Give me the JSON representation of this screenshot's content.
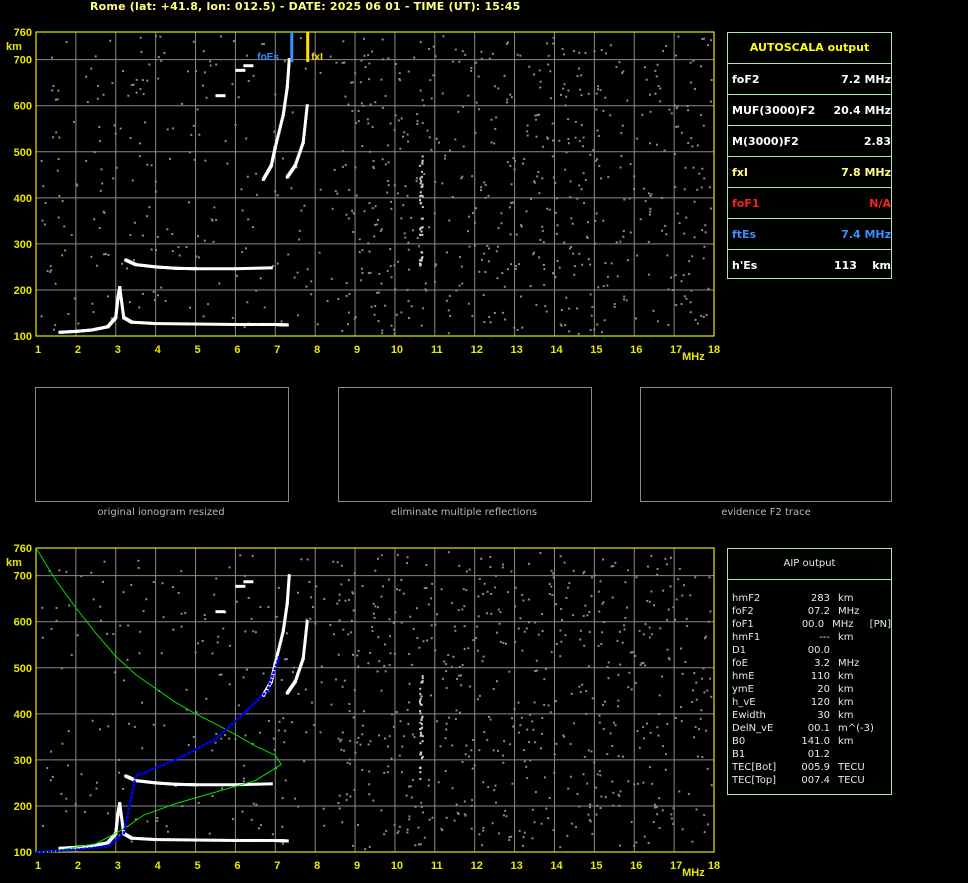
{
  "header": "Rome (lat: +41.8, lon: 012.5) - DATE: 2025 06 01 - TIME (UT): 15:45",
  "colors": {
    "axis": "#e8e800",
    "grid": "#8a8a8a",
    "trace": "#ffffff",
    "profile": "#0000ff",
    "model": "#00e000",
    "foEs": "#3a8fff",
    "fxI": "#ffe000",
    "foF1": "#ff2020"
  },
  "autoscala": {
    "title": "AUTOSCALA output",
    "rows": [
      {
        "label": "foF2",
        "value": "7.2",
        "unit": "MHz",
        "color": "#ffffff"
      },
      {
        "label": "MUF(3000)F2",
        "value": "20.4",
        "unit": "MHz",
        "color": "#ffffff"
      },
      {
        "label": "M(3000)F2",
        "value": "2.83",
        "unit": "",
        "color": "#ffffff"
      },
      {
        "label": "fxI",
        "value": "7.8",
        "unit": "MHz",
        "color": "#ffff80"
      },
      {
        "label": "foF1",
        "value": "N/A",
        "unit": "",
        "color": "#ff2020"
      },
      {
        "label": "ftEs",
        "value": "7.4",
        "unit": "MHz",
        "color": "#3a8fff"
      },
      {
        "label": "h'Es",
        "value": "113",
        "unit": "km",
        "color": "#ffffff"
      }
    ]
  },
  "aip": {
    "title": "AIP output",
    "rows": [
      {
        "k": "hmF2",
        "v": "283",
        "u": "km",
        "x": ""
      },
      {
        "k": "foF2",
        "v": "07.2",
        "u": "MHz",
        "x": ""
      },
      {
        "k": "foF1",
        "v": "00.0",
        "u": "MHz",
        "x": "[PN]"
      },
      {
        "k": "hmF1",
        "v": "---",
        "u": "km",
        "x": ""
      },
      {
        "k": "D1",
        "v": "00.0",
        "u": "",
        "x": ""
      },
      {
        "k": "foE",
        "v": "3.2",
        "u": "MHz",
        "x": ""
      },
      {
        "k": "hmE",
        "v": "110",
        "u": "km",
        "x": ""
      },
      {
        "k": "ymE",
        "v": "20",
        "u": "km",
        "x": ""
      },
      {
        "k": "h_vE",
        "v": "120",
        "u": "km",
        "x": ""
      },
      {
        "k": "Ewidth",
        "v": "30",
        "u": "km",
        "x": ""
      },
      {
        "k": "DelN_vE",
        "v": "00.1",
        "u": "m^(-3)",
        "x": ""
      },
      {
        "k": "B0",
        "v": "141.0",
        "u": "km",
        "x": ""
      },
      {
        "k": "B1",
        "v": "01.2",
        "u": "",
        "x": ""
      },
      {
        "k": "TEC[Bot]",
        "v": "005.9",
        "u": "TECU",
        "x": ""
      },
      {
        "k": "TEC[Top]",
        "v": "007.4",
        "u": "TECU",
        "x": ""
      }
    ]
  },
  "thumbnails": [
    {
      "caption": "original ionogram resized"
    },
    {
      "caption": "eliminate multiple reflections"
    },
    {
      "caption": "evidence F2 trace"
    }
  ],
  "chart_data": [
    {
      "type": "scatter",
      "title": "",
      "xlabel": "MHz",
      "ylabel": "km",
      "xlim": [
        1,
        18
      ],
      "ylim": [
        100,
        760
      ],
      "xticks": [
        1,
        2,
        3,
        4,
        5,
        6,
        7,
        8,
        9,
        10,
        11,
        12,
        13,
        14,
        15,
        16,
        17,
        18
      ],
      "yticks": [
        100,
        200,
        300,
        400,
        500,
        600,
        700,
        760
      ],
      "grid": true,
      "markers": [
        {
          "label": "foEs",
          "x": 7.4,
          "color": "#3a8fff"
        },
        {
          "label": "fxI",
          "x": 7.8,
          "color": "#ffe000"
        }
      ],
      "series": [
        {
          "name": "",
          "values": [
            [
              1.6,
              108
            ],
            [
              2.0,
              110
            ],
            [
              2.4,
              113
            ],
            [
              2.8,
              120
            ],
            [
              3.0,
              140
            ],
            [
              3.05,
              180
            ],
            [
              3.1,
              205
            ],
            [
              3.2,
              140
            ],
            [
              3.4,
              130
            ],
            [
              4,
              127
            ],
            [
              5,
              126
            ],
            [
              6,
              125
            ],
            [
              7,
              125
            ],
            [
              7.3,
              124
            ]
          ]
        },
        {
          "name": "",
          "values": [
            [
              3.25,
              265
            ],
            [
              3.5,
              255
            ],
            [
              4,
              250
            ],
            [
              4.5,
              247
            ],
            [
              5,
              246
            ],
            [
              6,
              246
            ],
            [
              6.9,
              248
            ]
          ]
        },
        {
          "name": "",
          "values": [
            [
              6.7,
              440
            ],
            [
              6.9,
              470
            ],
            [
              7.0,
              510
            ],
            [
              7.2,
              580
            ],
            [
              7.3,
              640
            ],
            [
              7.35,
              700
            ]
          ]
        },
        {
          "name": "",
          "values": [
            [
              7.3,
              445
            ],
            [
              7.5,
              470
            ],
            [
              7.7,
              520
            ],
            [
              7.8,
              600
            ]
          ]
        }
      ]
    },
    {
      "type": "line",
      "title": "",
      "xlabel": "MHz",
      "ylabel": "km",
      "xlim": [
        1,
        18
      ],
      "ylim": [
        100,
        760
      ],
      "xticks": [
        1,
        2,
        3,
        4,
        5,
        6,
        7,
        8,
        9,
        10,
        11,
        12,
        13,
        14,
        15,
        16,
        17,
        18
      ],
      "yticks": [
        100,
        200,
        300,
        400,
        500,
        600,
        700,
        760
      ],
      "grid": true,
      "series": [
        {
          "name": "",
          "values": [
            [
              1.0,
              100
            ],
            [
              2.0,
              105
            ],
            [
              2.8,
              112
            ],
            [
              3.2,
              140
            ],
            [
              3.5,
              265
            ],
            [
              4.5,
              300
            ],
            [
              5.5,
              345
            ],
            [
              6.2,
              400
            ],
            [
              6.8,
              450
            ],
            [
              7.1,
              525
            ]
          ]
        },
        {
          "name": "",
          "values": [
            [
              1.0,
              760
            ],
            [
              1.5,
              690
            ],
            [
              2,
              630
            ],
            [
              2.5,
              575
            ],
            [
              3,
              525
            ],
            [
              3.5,
              485
            ],
            [
              4,
              455
            ],
            [
              4.5,
              425
            ],
            [
              5,
              400
            ],
            [
              5.5,
              378
            ],
            [
              6,
              355
            ],
            [
              6.5,
              330
            ],
            [
              7.0,
              310
            ],
            [
              7.15,
              290
            ],
            [
              6.5,
              255
            ],
            [
              5.5,
              230
            ],
            [
              4.5,
              205
            ],
            [
              3.7,
              180
            ],
            [
              3.2,
              150
            ],
            [
              2.5,
              118
            ],
            [
              1.5,
              103
            ],
            [
              1.0,
              100
            ]
          ]
        }
      ]
    }
  ]
}
